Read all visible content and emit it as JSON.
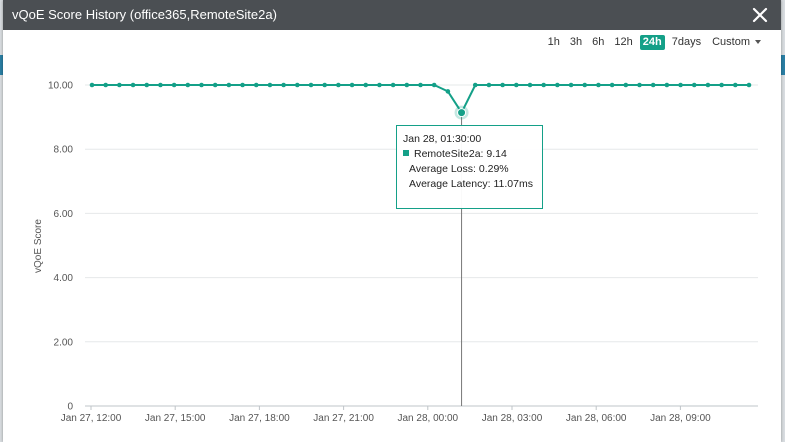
{
  "modal": {
    "title": "vQoE Score History (office365,RemoteSite2a)",
    "close_icon": "close-icon"
  },
  "time_range": {
    "options": [
      "1h",
      "3h",
      "6h",
      "12h",
      "24h",
      "7days"
    ],
    "selected": "24h",
    "custom_label": "Custom"
  },
  "colors": {
    "series": "#14a088",
    "header": "#4b4f53"
  },
  "tooltip": {
    "time": "Jan 28, 01:30:00",
    "series_line": "RemoteSite2a: 9.14",
    "loss_line": "Average Loss: 0.29%",
    "latency_line": "Average Latency: 11.07ms"
  },
  "chart_data": {
    "type": "line",
    "ylabel": "vQoE Score",
    "ylim": [
      0,
      10
    ],
    "yticks": [
      "0",
      "2.00",
      "4.00",
      "6.00",
      "8.00",
      "10.00"
    ],
    "xticks": [
      "Jan 27, 12:00",
      "Jan 27, 15:00",
      "Jan 27, 18:00",
      "Jan 27, 21:00",
      "Jan 28, 00:00",
      "Jan 28, 03:00",
      "Jan 28, 06:00",
      "Jan 28, 09:00"
    ],
    "grid": true,
    "series": [
      {
        "name": "RemoteSite2a",
        "values": [
          10,
          10,
          10,
          10,
          10,
          10,
          10,
          10,
          10,
          10,
          10,
          10,
          10,
          10,
          10,
          10,
          10,
          10,
          10,
          10,
          10,
          10,
          10,
          10,
          10,
          10,
          9.8,
          9.14,
          10,
          10,
          10,
          10,
          10,
          10,
          10,
          10,
          10,
          10,
          10,
          10,
          10,
          10,
          10,
          10,
          10,
          10,
          10,
          10,
          10
        ]
      }
    ],
    "highlight_index": 27
  }
}
